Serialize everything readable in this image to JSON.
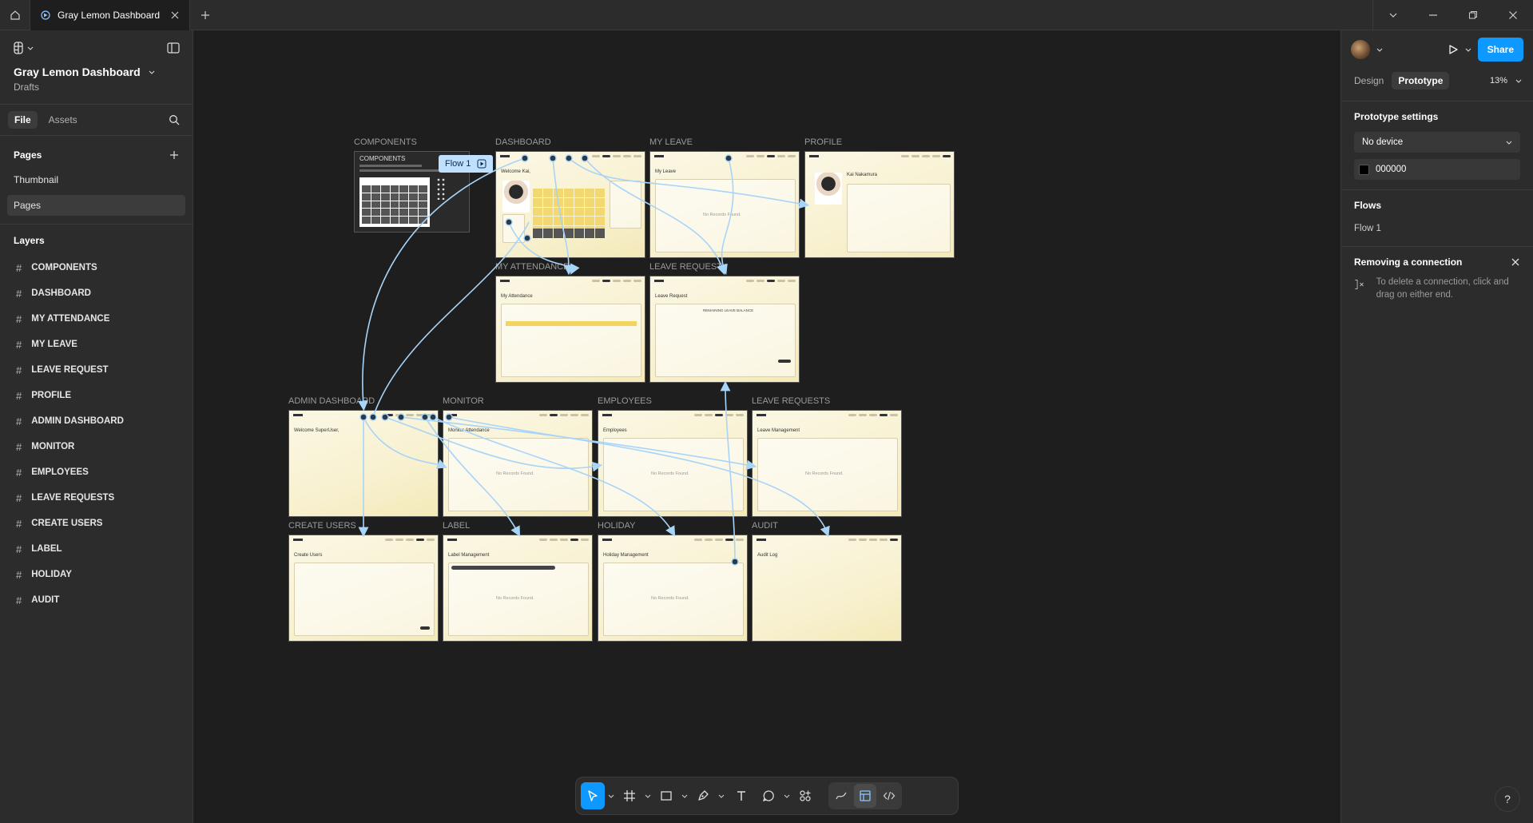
{
  "window": {
    "tab_title": "Gray Lemon Dashboard"
  },
  "left_panel": {
    "project_title": "Gray Lemon Dashboard",
    "project_location": "Drafts",
    "tabs": [
      "File",
      "Assets"
    ],
    "pages_heading": "Pages",
    "pages": [
      "Thumbnail",
      "Pages"
    ],
    "layers_heading": "Layers",
    "layers": [
      "COMPONENTS",
      "DASHBOARD",
      "MY ATTENDANCE",
      "MY LEAVE",
      "LEAVE REQUEST",
      "PROFILE",
      "ADMIN DASHBOARD",
      "MONITOR",
      "EMPLOYEES",
      "LEAVE REQUESTS",
      "CREATE USERS",
      "LABEL",
      "HOLIDAY",
      "AUDIT"
    ]
  },
  "canvas": {
    "flow_badge": "Flow 1",
    "frames": {
      "components": {
        "label": "COMPONENTS",
        "title": "COMPONENTS"
      },
      "dashboard": {
        "label": "DASHBOARD",
        "title": "Welcome Kai,"
      },
      "my_leave": {
        "label": "MY LEAVE",
        "title": "My Leave",
        "empty": "No Records Found."
      },
      "profile": {
        "label": "PROFILE",
        "title": "Kai Nakamura"
      },
      "my_attendance": {
        "label": "MY ATTENDANCE",
        "title": "My Attendance"
      },
      "leave_request": {
        "label": "LEAVE REQUEST",
        "title": "Leave Request",
        "subtitle": "REMAINING LEAVE BALANCE"
      },
      "admin_dashboard": {
        "label": "ADMIN DASHBOARD",
        "title": "Welcome SuperUser,"
      },
      "monitor": {
        "label": "MONITOR",
        "title": "Monitor Attendance",
        "empty": "No Records Found."
      },
      "employees": {
        "label": "EMPLOYEES",
        "title": "Employees",
        "empty": "No Records Found."
      },
      "leave_requests": {
        "label": "LEAVE REQUESTS",
        "title": "Leave Management",
        "empty": "No Records Found."
      },
      "create_users": {
        "label": "CREATE USERS",
        "title": "Create Users"
      },
      "label": {
        "label": "LABEL",
        "title": "Label Management",
        "empty": "No Records Found."
      },
      "holiday": {
        "label": "HOLIDAY",
        "title": "Holiday Management",
        "empty": "No Records Found."
      },
      "audit": {
        "label": "AUDIT",
        "title": "Audit Log"
      }
    }
  },
  "toolbar": {
    "tools": [
      "move-tool",
      "frame-tool",
      "shape-tool",
      "pen-tool",
      "text-tool",
      "comment-tool",
      "actions-tool"
    ],
    "modes": [
      "draw-mode",
      "design-mode",
      "dev-mode"
    ]
  },
  "right_panel": {
    "share_label": "Share",
    "tabs": [
      "Design",
      "Prototype"
    ],
    "active_tab": "Prototype",
    "zoom": "13%",
    "prototype_settings_heading": "Prototype settings",
    "device": "No device",
    "background_color": "000000",
    "flows_heading": "Flows",
    "flows": [
      "Flow 1"
    ],
    "removing_heading": "Removing a connection",
    "removing_text": "To delete a connection, click and drag on either end."
  },
  "colors": {
    "accent": "#0d99ff",
    "connection": "#a8d4f8",
    "frame_bg": "#f8f1d0",
    "canvas_bg": "#1e1e1e"
  }
}
